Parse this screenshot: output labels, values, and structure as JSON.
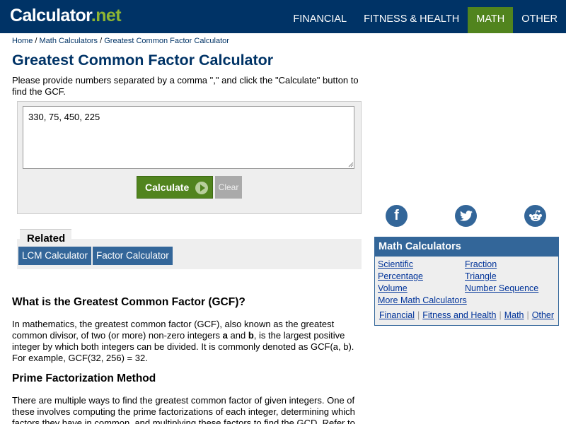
{
  "header": {
    "logo_main": "Calculator",
    "logo_net": ".net",
    "nav": [
      "FINANCIAL",
      "FITNESS & HEALTH",
      "MATH",
      "OTHER"
    ],
    "active": "MATH"
  },
  "breadcrumb": {
    "items": [
      "Home",
      "Math Calculators",
      "Greatest Common Factor Calculator"
    ],
    "separator": " / "
  },
  "page": {
    "title": "Greatest Common Factor Calculator",
    "intro": "Please provide numbers separated by a comma \",\" and click the \"Calculate\" button to find the GCF."
  },
  "calculator": {
    "input_value": "330, 75, 450, 225",
    "calculate_label": "Calculate",
    "clear_label": "Clear"
  },
  "related": {
    "title": "Related",
    "links": [
      "LCM Calculator",
      "Factor Calculator"
    ]
  },
  "content": {
    "what_heading": "What is the Greatest Common Factor (GCF)?",
    "what_p_before_a": "In mathematics, the greatest common factor (GCF), also known as the greatest common divisor, of two (or more) non-zero integers ",
    "var_a": "a",
    "and_word": " and ",
    "var_b": "b",
    "what_p_after_b": ", is the largest positive integer by which both integers can be divided. It is commonly denoted as GCF(a, b). For example, GCF(32, 256) = 32.",
    "prime_heading": "Prime Factorization Method",
    "prime_p": "There are multiple ways to find the greatest common factor of given integers. One of these involves computing the prime factorizations of each integer, determining which factors they have in common, and multiplying these factors to find the GCD. Refer to the example"
  },
  "social": {
    "icons": [
      "facebook-icon",
      "twitter-icon",
      "reddit-icon"
    ],
    "facebook_glyph": "f"
  },
  "sidebar": {
    "title": "Math Calculators",
    "links_left": [
      "Scientific",
      "Percentage",
      "Volume",
      "More Math Calculators"
    ],
    "links_right": [
      "Fraction",
      "Triangle",
      "Number Sequence"
    ],
    "footer": [
      "Financial",
      "Fitness and Health",
      "Math",
      "Other"
    ],
    "footer_sep": "|"
  },
  "colors": {
    "header_bg": "#003366",
    "accent_green": "#51841e",
    "link_blue": "#336699"
  }
}
